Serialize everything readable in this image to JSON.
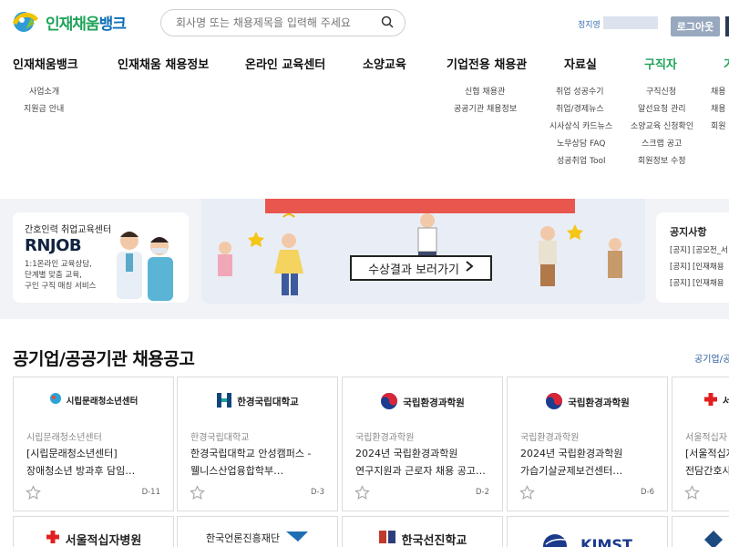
{
  "header": {
    "logo_text_a": "인재채움",
    "logo_text_b": "뱅크",
    "search_placeholder": "회사명 또는 채용제목을 입력해 주세요",
    "user_name": "정지영",
    "logout_label": "로그아웃"
  },
  "nav": {
    "items": [
      "인재채움뱅크",
      "인재채움 채용정보",
      "온라인 교육센터",
      "소양교육",
      "기업전용 채용관",
      "자료실",
      "구직자",
      "기"
    ],
    "sub_bank": [
      "사업소개",
      "지원금 안내"
    ],
    "sub_corp": [
      "신협 채용관",
      "공공기관 채용정보"
    ],
    "sub_data": [
      "취업 성공수기",
      "취업/경제뉴스",
      "시사상식 카드뉴스",
      "노무상담 FAQ",
      "성공취업 Tool"
    ],
    "sub_seeker": [
      "구직신청",
      "알선요청 관리",
      "소양교육 신청확인",
      "스크랩 공고",
      "회원정보 수정"
    ],
    "sub_edge": [
      "채용",
      "채용",
      "회원"
    ]
  },
  "banner": {
    "rn_title": "간호인력 취업교육센터",
    "rn_logo": "RNJOB",
    "rn_desc": [
      "1:1온라인 교육상담,",
      "단계별 맞춤 교육,",
      "구인 구직 매칭 서비스"
    ],
    "hero_cta": "수상결과 보러가기",
    "notice_title": "공지사항",
    "notice_lines": [
      "[공지] [공모전_서",
      "[공지] [인재채용",
      "[공지] [인재채용"
    ]
  },
  "section": {
    "title": "공기업/공공기관 채용공고",
    "more": "공기업/공"
  },
  "jobs": [
    {
      "logo": "시립문래청소년센터",
      "org": "시립문래청소년센터",
      "line1": "[시립문래청소년센터]",
      "line2": "장애청소년 방과후 담임…",
      "dday": "D-11"
    },
    {
      "logo": "한경국립대학교",
      "org": "한경국립대학교",
      "line1": "한경국립대학교 안성캠퍼스 -",
      "line2": "웰니스산업융합학부…",
      "dday": "D-3"
    },
    {
      "logo": "국립환경과학원",
      "org": "국립환경과학원",
      "line1": "2024년 국립환경과학원",
      "line2": "연구지원과 근로자 채용 공고…",
      "dday": "D-2"
    },
    {
      "logo": "국립환경과학원",
      "org": "국립환경과학원",
      "line1": "2024년 국립환경과학원",
      "line2": "가습기살균제보건센터…",
      "dday": "D-6"
    },
    {
      "logo": "서",
      "org": "서울적십자",
      "line1": "[서울적십자",
      "line2": "전담간호사",
      "dday": ""
    }
  ],
  "jobs_row2": [
    "서울적십자병원",
    "한국언론진흥재단",
    "한국선진학교",
    "KIMST",
    ""
  ]
}
